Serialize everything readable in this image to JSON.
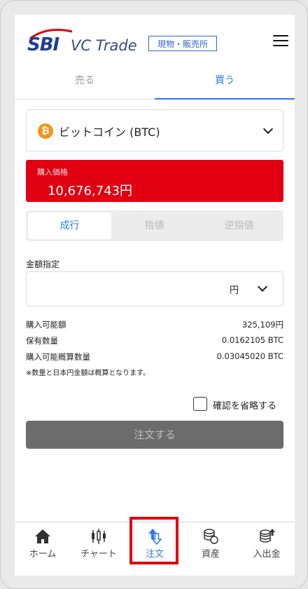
{
  "header": {
    "logo_text_sbi": "SBI",
    "logo_text_vc": "VC Trade",
    "badge": "現物・販売所",
    "menu_icon": "hamburger-menu-icon"
  },
  "tabs": [
    {
      "label": "売る",
      "active": false
    },
    {
      "label": "買う",
      "active": true
    }
  ],
  "coin": {
    "icon": "bitcoin-icon",
    "icon_glyph": "₿",
    "name": "ビットコイン (BTC)"
  },
  "price": {
    "label": "購入価格",
    "value": "10,676,743円"
  },
  "order_types": [
    {
      "label": "成行",
      "active": true
    },
    {
      "label": "指値",
      "active": false
    },
    {
      "label": "逆指値",
      "active": false
    }
  ],
  "amount": {
    "label": "金額指定",
    "value": "",
    "unit": "円"
  },
  "info": [
    {
      "key": "購入可能額",
      "value": "325,109円"
    },
    {
      "key": "保有数量",
      "value": "0.0162105 BTC"
    },
    {
      "key": "購入可能概算数量",
      "value": "0.03045020 BTC"
    }
  ],
  "note": "※数量と日本円金額は概算となります。",
  "skip_confirm": {
    "label": "確認を省略する",
    "checked": false
  },
  "order_button": "注文する",
  "bottom_nav": [
    {
      "label": "ホーム",
      "icon": "home-icon",
      "active": false
    },
    {
      "label": "チャート",
      "icon": "candlestick-chart-icon",
      "active": false
    },
    {
      "label": "注文",
      "icon": "order-arrows-icon",
      "active": true
    },
    {
      "label": "資産",
      "icon": "coins-icon",
      "active": false
    },
    {
      "label": "入出金",
      "icon": "deposit-withdraw-icon",
      "active": false
    }
  ],
  "colors": {
    "accent": "#2f7be0",
    "price_bg": "#e00012",
    "btc": "#f5931a",
    "brand": "#1f3f91"
  }
}
